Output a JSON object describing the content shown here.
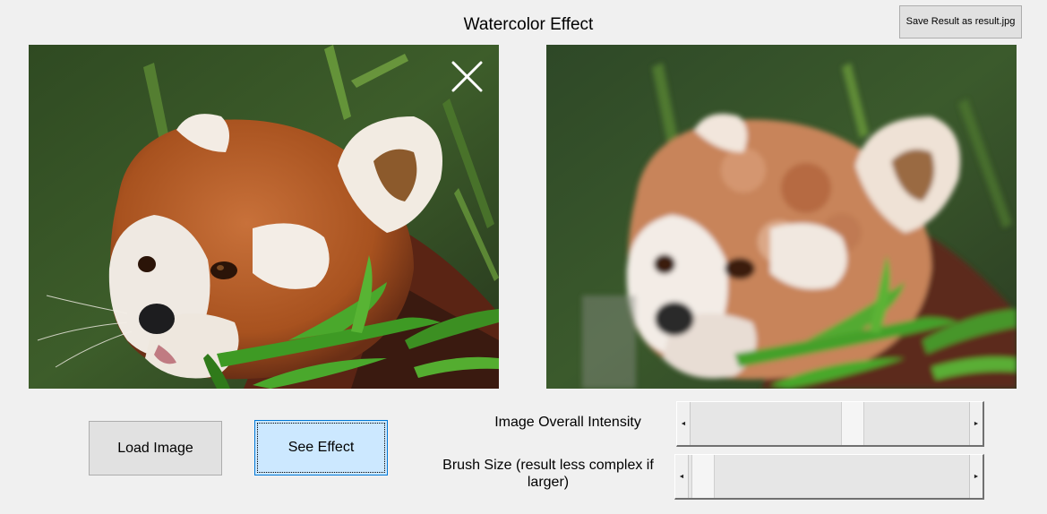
{
  "window": {
    "title": "Watercolor Effect"
  },
  "toolbar": {
    "save_label": "Save Result as result.jpg"
  },
  "images": {
    "original_icon": "close-icon",
    "original_subject": "red panda eating bamboo",
    "result_subject": "watercolor red panda"
  },
  "controls": {
    "load_label": "Load Image",
    "effect_label": "See Effect",
    "intensity_label": "Image Overall Intensity",
    "intensity_value": 0.59,
    "brush_label": "Brush Size (result less complex if larger)",
    "brush_value": 0.01,
    "arrow_left": "◄",
    "arrow_right": "►"
  },
  "colors": {
    "selected_button_bg": "#cce8ff",
    "selected_button_border": "#0078d7",
    "button_bg": "#e1e1e1",
    "window_bg": "#f0f0f0"
  }
}
